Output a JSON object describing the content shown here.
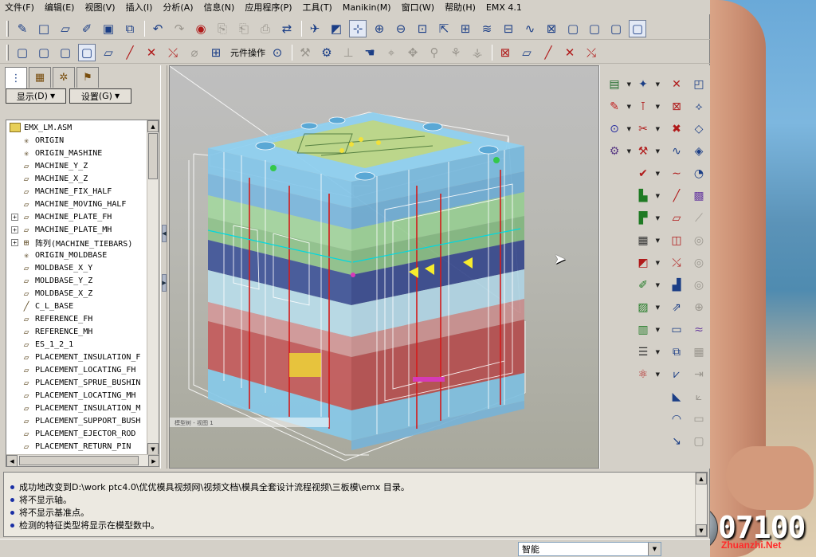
{
  "menu": [
    "文件(F)",
    "编辑(E)",
    "视图(V)",
    "插入(I)",
    "分析(A)",
    "信息(N)",
    "应用程序(P)",
    "工具(T)",
    "Manikin(M)",
    "窗口(W)",
    "帮助(H)",
    "EMX 4.1"
  ],
  "toolbar2": {
    "component_ops_label": "元件操作"
  },
  "left_panel": {
    "display_button": "显示",
    "display_key": "(D)",
    "settings_button": "设置",
    "settings_key": "(G)"
  },
  "model_tree": {
    "root": "EMX_LM.ASM",
    "items": [
      {
        "label": "ORIGIN",
        "icon": "csys-icon",
        "expandable": false
      },
      {
        "label": "ORIGIN_MASHINE",
        "icon": "csys-icon",
        "expandable": false
      },
      {
        "label": "MACHINE_Y_Z",
        "icon": "datum-plane-icon",
        "expandable": false
      },
      {
        "label": "MACHINE_X_Z",
        "icon": "datum-plane-icon",
        "expandable": false
      },
      {
        "label": "MACHINE_FIX_HALF",
        "icon": "datum-plane-icon",
        "expandable": false
      },
      {
        "label": "MACHINE_MOVING_HALF",
        "icon": "datum-plane-icon",
        "expandable": false
      },
      {
        "label": "MACHINE_PLATE_FH",
        "icon": "datum-plane-icon",
        "expandable": true
      },
      {
        "label": "MACHINE_PLATE_MH",
        "icon": "datum-plane-icon",
        "expandable": true
      },
      {
        "label": "阵列(MACHINE_TIEBARS)",
        "icon": "pattern-icon",
        "expandable": true
      },
      {
        "label": "ORIGIN_MOLDBASE",
        "icon": "csys-icon",
        "expandable": false
      },
      {
        "label": "MOLDBASE_X_Y",
        "icon": "datum-plane-icon",
        "expandable": false
      },
      {
        "label": "MOLDBASE_Y_Z",
        "icon": "datum-plane-icon",
        "expandable": false
      },
      {
        "label": "MOLDBASE_X_Z",
        "icon": "datum-plane-icon",
        "expandable": false
      },
      {
        "label": "C_L_BASE",
        "icon": "datum-axis-icon",
        "expandable": false
      },
      {
        "label": "REFERENCE_FH",
        "icon": "datum-plane-icon",
        "expandable": false
      },
      {
        "label": "REFERENCE_MH",
        "icon": "datum-plane-icon",
        "expandable": false
      },
      {
        "label": "ES_1_2_1",
        "icon": "datum-plane-icon",
        "expandable": false
      },
      {
        "label": "PLACEMENT_INSULATION_F",
        "icon": "datum-plane-icon",
        "expandable": false
      },
      {
        "label": "PLACEMENT_LOCATING_FH",
        "icon": "datum-plane-icon",
        "expandable": false
      },
      {
        "label": "PLACEMENT_SPRUE_BUSHIN",
        "icon": "datum-plane-icon",
        "expandable": false
      },
      {
        "label": "PLACEMENT_LOCATING_MH",
        "icon": "datum-plane-icon",
        "expandable": false
      },
      {
        "label": "PLACEMENT_INSULATION_M",
        "icon": "datum-plane-icon",
        "expandable": false
      },
      {
        "label": "PLACEMENT_SUPPORT_BUSH",
        "icon": "datum-plane-icon",
        "expandable": false
      },
      {
        "label": "PLACEMENT_EJECTOR_ROD",
        "icon": "datum-plane-icon",
        "expandable": false
      },
      {
        "label": "PLACEMENT_RETURN_PIN",
        "icon": "datum-plane-icon",
        "expandable": false
      }
    ]
  },
  "viewport": {
    "caption": "模型树 - 视图 1"
  },
  "messages": [
    "成功地改变到D:\\work ptc4.0\\优优模具视频网\\视频文档\\模具全套设计流程视频\\三板模\\emx 目录。",
    "将不显示轴。",
    "将不显示基准点。",
    "检测的特征类型将显示在模型数中。"
  ],
  "status": {
    "filter_value": "智能"
  },
  "watermark": {
    "text": "07100",
    "site": "Zhuanzhi.Net"
  },
  "colors": {
    "selection": "#e3e9f5",
    "message_bullet": "#1a2fa5",
    "plate_blue": "#7ec3e6",
    "plate_green": "#9fd49a",
    "plate_red": "#c05656",
    "plate_navy": "#3a4f93"
  }
}
